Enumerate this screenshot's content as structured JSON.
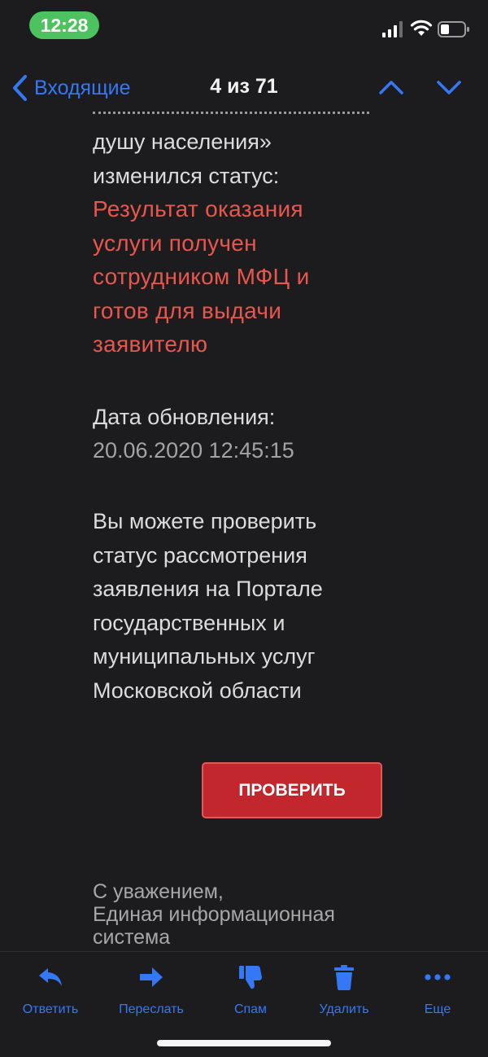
{
  "status_bar": {
    "time": "12:28"
  },
  "nav": {
    "back_label": "Входящие",
    "position": "4 из 71"
  },
  "message": {
    "lines_top": [
      "душу населения»",
      "изменился статус:"
    ],
    "status_lines": [
      "Результат оказания",
      "услуги получен",
      "сотрудником МФЦ и",
      "готов для выдачи",
      "заявителю"
    ],
    "date_label": "Дата обновления:",
    "date_value": "20.06.2020 12:45:15",
    "info_lines": [
      "Вы можете проверить",
      "статус рассмотрения",
      "заявления на Портале",
      "государственных и",
      "муниципальных услуг",
      "Московской области"
    ],
    "button_label": "ПРОВЕРИТЬ",
    "regards_lines": [
      "С уважением,",
      "Единая информационная",
      "система"
    ]
  },
  "toolbar": {
    "reply": "Ответить",
    "forward": "Переслать",
    "spam": "Спам",
    "delete": "Удалить",
    "more": "Еще"
  },
  "colors": {
    "accent": "#3478f6",
    "status_text": "#e8574d",
    "button": "#c1272d",
    "time_pill": "#4cc35e"
  }
}
